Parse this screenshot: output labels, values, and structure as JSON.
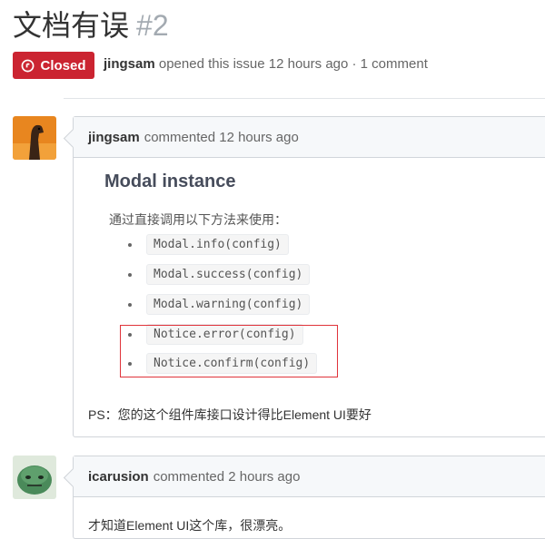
{
  "issue": {
    "title": "文档有误",
    "number": "#2",
    "state": "Closed",
    "author": "jingsam",
    "meta_rest": "opened this issue 12 hours ago · 1 comment"
  },
  "comments": [
    {
      "author": "jingsam",
      "time": "commented 12 hours ago",
      "embed_title": "Modal instance",
      "intro": "通过直接调用以下方法来使用：",
      "api_items": [
        "Modal.info(config)",
        "Modal.success(config)",
        "Modal.warning(config)",
        "Notice.error(config)",
        "Notice.confirm(config)"
      ],
      "body": "PS：您的这个组件库接口设计得比Element UI要好"
    },
    {
      "author": "icarusion",
      "time": "commented 2 hours ago",
      "body": "才知道Element UI这个库，很漂亮。"
    }
  ],
  "colors": {
    "closed_badge": "#cb2431",
    "highlight_box": "#e0333a"
  }
}
